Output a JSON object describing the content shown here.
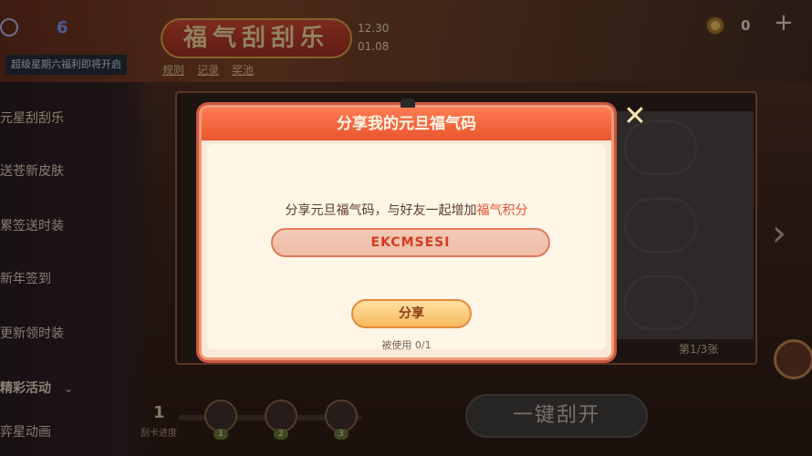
{
  "header": {
    "notice": "超级星期六福利即将开启",
    "logo_text": "6",
    "event_title": "福气刮刮乐",
    "date_start": "12.30",
    "date_end": "01.08",
    "tabs": [
      {
        "label": "规则"
      },
      {
        "label": "记录"
      },
      {
        "label": "奖池"
      }
    ],
    "coin_count": "0",
    "plus": "+"
  },
  "sidebar": {
    "items": [
      {
        "label": "元星刮刮乐"
      },
      {
        "label": "送苍新皮肤"
      },
      {
        "label": "累签送时装"
      },
      {
        "label": "新年签到"
      },
      {
        "label": "更新领时装"
      },
      {
        "label": "精彩活动"
      },
      {
        "label": "弈星动画"
      }
    ]
  },
  "board": {
    "page_indicator": "第1/3张",
    "progress_number": "1",
    "progress_label": "刮卡进度",
    "reward_badges": [
      "1",
      "2",
      "3"
    ],
    "scratch_all_label": "一键刮开"
  },
  "modal": {
    "title": "分享我的元旦福气码",
    "description_prefix": "分享元旦福气码，与好友一起增加",
    "description_highlight": "福气积分",
    "code": "EKCMSESI",
    "share_label": "分享",
    "usage": "被使用 0/1",
    "close": "✕"
  },
  "colors": {
    "accent": "#e9562f",
    "highlight_text": "#e5532e",
    "modal_bg": "#fbe9d7"
  }
}
